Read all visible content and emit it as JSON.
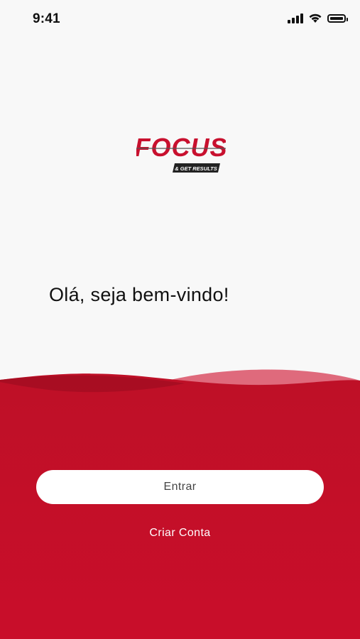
{
  "status_bar": {
    "time": "9:41"
  },
  "logo": {
    "title": "FOCUS",
    "tagline": "& GET RESULTS"
  },
  "welcome": {
    "message": "Olá, seja bem-vindo!"
  },
  "actions": {
    "enter_label": "Entrar",
    "create_account_label": "Criar Conta"
  },
  "colors": {
    "brand_red": "#c8102e",
    "background": "#f8f8f8",
    "button_bg": "#ffffff"
  }
}
